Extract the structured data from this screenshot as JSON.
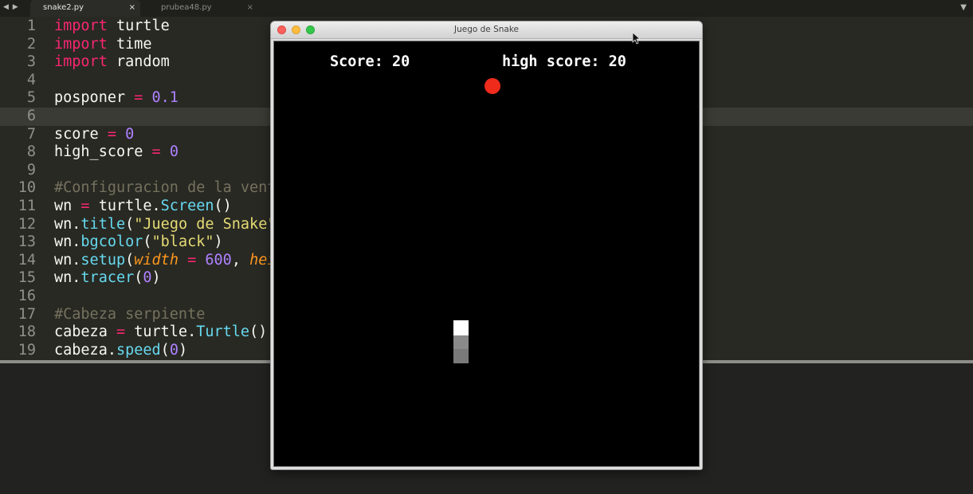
{
  "tabs": [
    {
      "label": "snake2.py",
      "close": "×"
    },
    {
      "label": "prubea48.py",
      "close": "×"
    }
  ],
  "nav_arrows": "◀ ▶",
  "tab_menu": "▼",
  "editor": {
    "lines": [
      {
        "n": "1"
      },
      {
        "n": "2"
      },
      {
        "n": "3"
      },
      {
        "n": "4"
      },
      {
        "n": "5"
      },
      {
        "n": "6"
      },
      {
        "n": "7"
      },
      {
        "n": "8"
      },
      {
        "n": "9"
      },
      {
        "n": "10"
      },
      {
        "n": "11"
      },
      {
        "n": "12"
      },
      {
        "n": "13"
      },
      {
        "n": "14"
      },
      {
        "n": "15"
      },
      {
        "n": "16"
      },
      {
        "n": "17"
      },
      {
        "n": "18"
      },
      {
        "n": "19"
      }
    ],
    "code": {
      "l1": [
        "import",
        " turtle"
      ],
      "l2": [
        "import",
        " time"
      ],
      "l3": [
        "import",
        " random"
      ],
      "l5": [
        "posponer ",
        "=",
        " ",
        "0.1"
      ],
      "l7": [
        "score ",
        "=",
        " ",
        "0"
      ],
      "l8": [
        "high_score ",
        "=",
        " ",
        "0"
      ],
      "l10": "#Configuracion de la ventana",
      "l11": [
        "wn ",
        "=",
        " turtle.",
        "Screen",
        "()"
      ],
      "l12": [
        "wn.",
        "title",
        "(",
        "\"Juego de Snake\"",
        ")"
      ],
      "l13": [
        "wn.",
        "bgcolor",
        "(",
        "\"black\"",
        ")"
      ],
      "l14": [
        "wn.",
        "setup",
        "(",
        "width",
        " = ",
        "600",
        ", ",
        "height"
      ],
      "l15": [
        "wn.",
        "tracer",
        "(",
        "0",
        ")"
      ],
      "l17": "#Cabeza serpiente",
      "l18": [
        "cabeza ",
        "=",
        " turtle.",
        "Turtle",
        "()"
      ],
      "l19": [
        "cabeza.",
        "speed",
        "(",
        "0",
        ")"
      ]
    }
  },
  "game_window": {
    "title": "Juego de Snake",
    "score_text": "Score: 20",
    "high_score_text": "high score: 20",
    "score": 20,
    "high_score": 20,
    "food_color": "#ef2b1c",
    "background_color": "#000000"
  }
}
